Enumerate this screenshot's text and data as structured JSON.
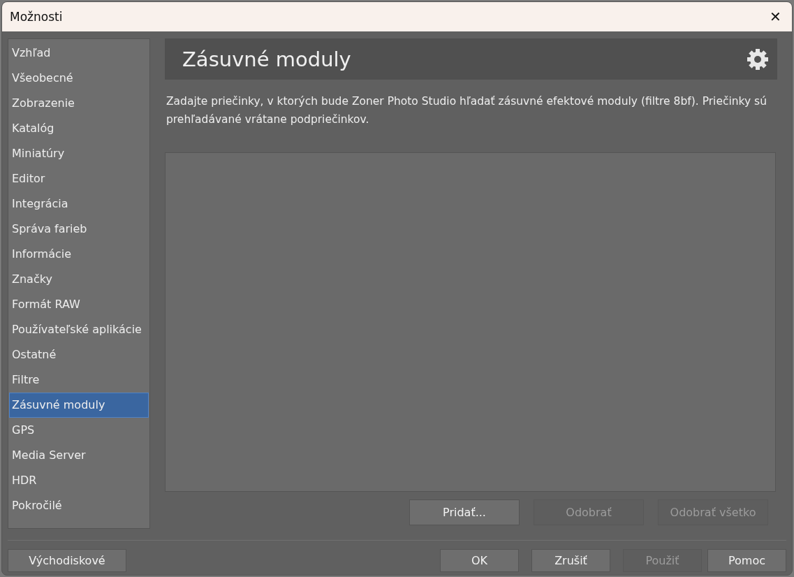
{
  "window": {
    "title": "Možnosti",
    "close": "✕"
  },
  "sidebar": {
    "items": [
      {
        "label": "Vzhľad",
        "selected": false
      },
      {
        "label": "Všeobecné",
        "selected": false
      },
      {
        "label": "Zobrazenie",
        "selected": false
      },
      {
        "label": "Katalóg",
        "selected": false
      },
      {
        "label": "Miniatúry",
        "selected": false
      },
      {
        "label": "Editor",
        "selected": false
      },
      {
        "label": "Integrácia",
        "selected": false
      },
      {
        "label": "Správa farieb",
        "selected": false
      },
      {
        "label": "Informácie",
        "selected": false
      },
      {
        "label": "Značky",
        "selected": false
      },
      {
        "label": "Formát RAW",
        "selected": false
      },
      {
        "label": "Používateľské aplikácie",
        "selected": false
      },
      {
        "label": "Ostatné",
        "selected": false
      },
      {
        "label": "Filtre",
        "selected": false
      },
      {
        "label": "Zásuvné moduly",
        "selected": true
      },
      {
        "label": "GPS",
        "selected": false
      },
      {
        "label": "Media Server",
        "selected": false
      },
      {
        "label": "HDR",
        "selected": false
      },
      {
        "label": "Pokročilé",
        "selected": false
      }
    ]
  },
  "panel": {
    "title": "Zásuvné moduly",
    "description": "Zadajte priečinky, v ktorých bude Zoner Photo Studio hľadať zásuvné efektové moduly (filtre 8bf). Priečinky sú prehľadávané vrátane podpriečinkov.",
    "list_buttons": [
      {
        "label": "Pridať...",
        "disabled": false
      },
      {
        "label": "Odobrať",
        "disabled": true
      },
      {
        "label": "Odobrať všetko",
        "disabled": true
      }
    ]
  },
  "footer": {
    "left_button": {
      "label": "Východiskové",
      "disabled": false
    },
    "buttons": [
      {
        "label": "OK",
        "disabled": false
      },
      {
        "label": "Zrušiť",
        "disabled": false
      },
      {
        "label": "Použiť",
        "disabled": true
      },
      {
        "label": "Pomoc",
        "disabled": false
      }
    ]
  }
}
